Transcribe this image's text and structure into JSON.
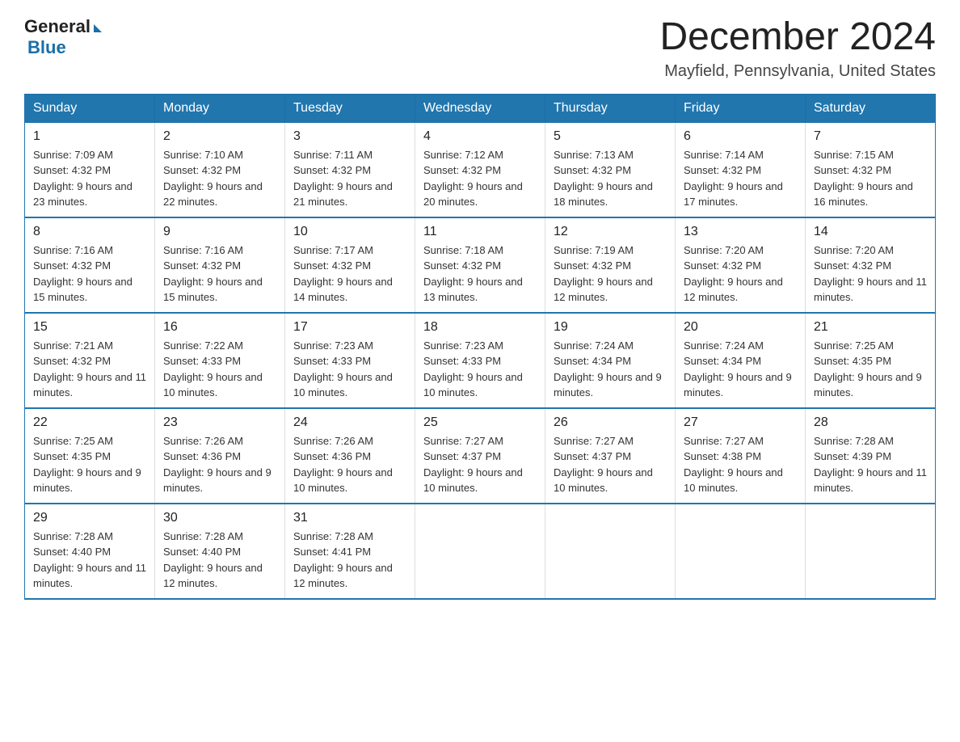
{
  "logo": {
    "general": "General",
    "blue": "Blue"
  },
  "header": {
    "month": "December 2024",
    "location": "Mayfield, Pennsylvania, United States"
  },
  "weekdays": [
    "Sunday",
    "Monday",
    "Tuesday",
    "Wednesday",
    "Thursday",
    "Friday",
    "Saturday"
  ],
  "weeks": [
    [
      {
        "day": "1",
        "sunrise": "Sunrise: 7:09 AM",
        "sunset": "Sunset: 4:32 PM",
        "daylight": "Daylight: 9 hours and 23 minutes."
      },
      {
        "day": "2",
        "sunrise": "Sunrise: 7:10 AM",
        "sunset": "Sunset: 4:32 PM",
        "daylight": "Daylight: 9 hours and 22 minutes."
      },
      {
        "day": "3",
        "sunrise": "Sunrise: 7:11 AM",
        "sunset": "Sunset: 4:32 PM",
        "daylight": "Daylight: 9 hours and 21 minutes."
      },
      {
        "day": "4",
        "sunrise": "Sunrise: 7:12 AM",
        "sunset": "Sunset: 4:32 PM",
        "daylight": "Daylight: 9 hours and 20 minutes."
      },
      {
        "day": "5",
        "sunrise": "Sunrise: 7:13 AM",
        "sunset": "Sunset: 4:32 PM",
        "daylight": "Daylight: 9 hours and 18 minutes."
      },
      {
        "day": "6",
        "sunrise": "Sunrise: 7:14 AM",
        "sunset": "Sunset: 4:32 PM",
        "daylight": "Daylight: 9 hours and 17 minutes."
      },
      {
        "day": "7",
        "sunrise": "Sunrise: 7:15 AM",
        "sunset": "Sunset: 4:32 PM",
        "daylight": "Daylight: 9 hours and 16 minutes."
      }
    ],
    [
      {
        "day": "8",
        "sunrise": "Sunrise: 7:16 AM",
        "sunset": "Sunset: 4:32 PM",
        "daylight": "Daylight: 9 hours and 15 minutes."
      },
      {
        "day": "9",
        "sunrise": "Sunrise: 7:16 AM",
        "sunset": "Sunset: 4:32 PM",
        "daylight": "Daylight: 9 hours and 15 minutes."
      },
      {
        "day": "10",
        "sunrise": "Sunrise: 7:17 AM",
        "sunset": "Sunset: 4:32 PM",
        "daylight": "Daylight: 9 hours and 14 minutes."
      },
      {
        "day": "11",
        "sunrise": "Sunrise: 7:18 AM",
        "sunset": "Sunset: 4:32 PM",
        "daylight": "Daylight: 9 hours and 13 minutes."
      },
      {
        "day": "12",
        "sunrise": "Sunrise: 7:19 AM",
        "sunset": "Sunset: 4:32 PM",
        "daylight": "Daylight: 9 hours and 12 minutes."
      },
      {
        "day": "13",
        "sunrise": "Sunrise: 7:20 AM",
        "sunset": "Sunset: 4:32 PM",
        "daylight": "Daylight: 9 hours and 12 minutes."
      },
      {
        "day": "14",
        "sunrise": "Sunrise: 7:20 AM",
        "sunset": "Sunset: 4:32 PM",
        "daylight": "Daylight: 9 hours and 11 minutes."
      }
    ],
    [
      {
        "day": "15",
        "sunrise": "Sunrise: 7:21 AM",
        "sunset": "Sunset: 4:32 PM",
        "daylight": "Daylight: 9 hours and 11 minutes."
      },
      {
        "day": "16",
        "sunrise": "Sunrise: 7:22 AM",
        "sunset": "Sunset: 4:33 PM",
        "daylight": "Daylight: 9 hours and 10 minutes."
      },
      {
        "day": "17",
        "sunrise": "Sunrise: 7:23 AM",
        "sunset": "Sunset: 4:33 PM",
        "daylight": "Daylight: 9 hours and 10 minutes."
      },
      {
        "day": "18",
        "sunrise": "Sunrise: 7:23 AM",
        "sunset": "Sunset: 4:33 PM",
        "daylight": "Daylight: 9 hours and 10 minutes."
      },
      {
        "day": "19",
        "sunrise": "Sunrise: 7:24 AM",
        "sunset": "Sunset: 4:34 PM",
        "daylight": "Daylight: 9 hours and 9 minutes."
      },
      {
        "day": "20",
        "sunrise": "Sunrise: 7:24 AM",
        "sunset": "Sunset: 4:34 PM",
        "daylight": "Daylight: 9 hours and 9 minutes."
      },
      {
        "day": "21",
        "sunrise": "Sunrise: 7:25 AM",
        "sunset": "Sunset: 4:35 PM",
        "daylight": "Daylight: 9 hours and 9 minutes."
      }
    ],
    [
      {
        "day": "22",
        "sunrise": "Sunrise: 7:25 AM",
        "sunset": "Sunset: 4:35 PM",
        "daylight": "Daylight: 9 hours and 9 minutes."
      },
      {
        "day": "23",
        "sunrise": "Sunrise: 7:26 AM",
        "sunset": "Sunset: 4:36 PM",
        "daylight": "Daylight: 9 hours and 9 minutes."
      },
      {
        "day": "24",
        "sunrise": "Sunrise: 7:26 AM",
        "sunset": "Sunset: 4:36 PM",
        "daylight": "Daylight: 9 hours and 10 minutes."
      },
      {
        "day": "25",
        "sunrise": "Sunrise: 7:27 AM",
        "sunset": "Sunset: 4:37 PM",
        "daylight": "Daylight: 9 hours and 10 minutes."
      },
      {
        "day": "26",
        "sunrise": "Sunrise: 7:27 AM",
        "sunset": "Sunset: 4:37 PM",
        "daylight": "Daylight: 9 hours and 10 minutes."
      },
      {
        "day": "27",
        "sunrise": "Sunrise: 7:27 AM",
        "sunset": "Sunset: 4:38 PM",
        "daylight": "Daylight: 9 hours and 10 minutes."
      },
      {
        "day": "28",
        "sunrise": "Sunrise: 7:28 AM",
        "sunset": "Sunset: 4:39 PM",
        "daylight": "Daylight: 9 hours and 11 minutes."
      }
    ],
    [
      {
        "day": "29",
        "sunrise": "Sunrise: 7:28 AM",
        "sunset": "Sunset: 4:40 PM",
        "daylight": "Daylight: 9 hours and 11 minutes."
      },
      {
        "day": "30",
        "sunrise": "Sunrise: 7:28 AM",
        "sunset": "Sunset: 4:40 PM",
        "daylight": "Daylight: 9 hours and 12 minutes."
      },
      {
        "day": "31",
        "sunrise": "Sunrise: 7:28 AM",
        "sunset": "Sunset: 4:41 PM",
        "daylight": "Daylight: 9 hours and 12 minutes."
      },
      null,
      null,
      null,
      null
    ]
  ]
}
